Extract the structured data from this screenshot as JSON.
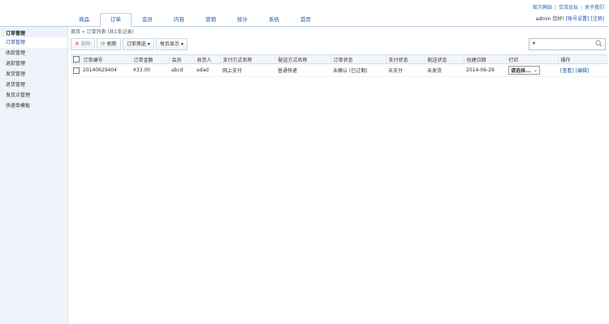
{
  "top_links": [
    "官方网站",
    "交流论坛",
    "关于我们"
  ],
  "nav": {
    "tabs": [
      "商品",
      "订单",
      "会员",
      "内容",
      "营销",
      "统计",
      "系统",
      "首页"
    ],
    "active_index": 1
  },
  "user": {
    "name": "admin",
    "greeting": "您好!",
    "account_settings": "[账号设置]",
    "logout": "[注销]"
  },
  "sidebar": {
    "title": "订单管理",
    "items": [
      "订单管理",
      "收款管理",
      "退款管理",
      "发货管理",
      "退货管理",
      "发货点管理",
      "快递单模板"
    ],
    "active_index": 0
  },
  "breadcrumb": "首页 » 订单列表 (共1条记录)",
  "toolbar": {
    "delete": "删除",
    "refresh": "刷新",
    "filter": "订单筛选",
    "page_size": "每页显示"
  },
  "search": {
    "dropdown": "▾",
    "placeholder": ""
  },
  "table": {
    "headers": [
      "订单编号",
      "订单金额",
      "会员",
      "收货人",
      "支付方式名称",
      "配送方式名称",
      "订单状态",
      "支付状态",
      "配送状态",
      "创建日期",
      "打印",
      "操作"
    ],
    "rows": [
      {
        "id": "20140629404",
        "amount": "¥33.00",
        "member": "abcd",
        "consignee": "adad",
        "payment": "网上支付",
        "delivery": "普通快递",
        "order_status": "未确认 (已过期)",
        "payment_status": "未支付",
        "shipping_status": "未发货",
        "date": "2014-06-29",
        "print": "请选择...",
        "view": "[查看]",
        "edit": "[编辑]"
      }
    ]
  }
}
